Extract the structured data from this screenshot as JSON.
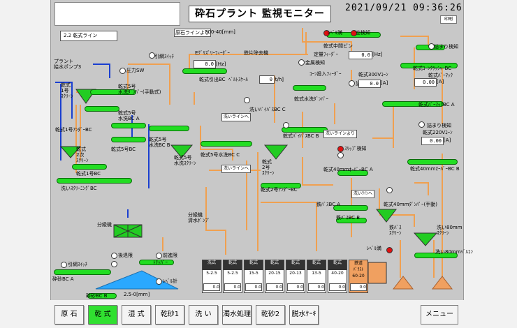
{
  "header": {
    "title": "砕石プラント 監視モニター",
    "datetime": "2021/09/21  09:36:26",
    "print_label": "印刷",
    "line_name": "2.2 乾式ライン"
  },
  "labels": {
    "plant_pump": "プラント\n給水ポンプ3",
    "pressure_sw": "圧力SW",
    "from_crushed_line": "原石ラインより",
    "range_300_40": "300-40[mm]",
    "pull_switch": "引綱ｽｲｯﾁ",
    "e_feeder": "Eｸﾞﾘｽﾞﾘｰﾌｨｰﾀﾞｰ",
    "iron_remover": "鉄片除去機",
    "metal_detect": "金属検知",
    "dry_pull_bc": "乾式引出BC",
    "belt_scale": "ﾍﾞﾙﾄｽｹｰﾙ",
    "hz": "[Hz]",
    "th": "[t/h]",
    "a": "[A]",
    "dry_1_screen": "乾式\n1号\nｽｸﾘｰﾝ",
    "dry_5_damper": "乾式5号\n水洗ﾀﾞﾝﾊﾟｰ(手動式)",
    "dry_5_wash_bc_a": "乾式5号\n水洗BC A",
    "dry_5_wash_bc_b": "乾式5号\n水洗BC B",
    "dry_5_wash_screen": "乾式5号\n水洗ｽｸﾘｰﾝ",
    "dry_1_under_bc": "乾式1号ｱﾝﾀﾞｰBC",
    "dry_5_bc": "乾式5号BC",
    "dry_5_wash_bc_c": "乾式5号水洗BC C",
    "dry_2_screen": "乾式\n2次\nｽｸﾘｰﾝ",
    "dry_1_bc": "乾式1号BC",
    "wash_screening_bc": "洗いｽｸﾘｰﾆﾝｸﾞBC",
    "wash_line_1": "洗いラインへ",
    "wash_line_2": "洗いラインへ",
    "dry_middle_bin": "乾式中間ビン",
    "level_full": "ﾚﾍﾞﾙ満",
    "empty_detect": "空検知",
    "fixed_feeder": "定量ﾌｨｰﾀﾞｰ",
    "cone_feeder": "ｺｰﾝ投入ﾌｨｰﾀﾞｰ",
    "clog_detect": "詰まり検知",
    "dry_300v_cone": "乾式300Vｺｰﾝ",
    "dry_cone_crusher_bc": "乾式ｺｰﾝｸﾗｯｼｬｰBC",
    "dry_bar_mac": "乾式ﾊﾞｰﾏｯｸ",
    "dry_wash_damper": "乾式水洗ﾀﾞﾝﾊﾟｰ",
    "wash_bypass_bc_c": "洗いﾊﾞｲﾊﾟｽBC C",
    "dry_bypass_bc_b": "乾式ﾊﾞｲﾊﾟｽBC B",
    "dry_barmac_bc_a": "乾式ﾊﾞｰﾏｯｸBC A",
    "dry_barmac_bc_b": "乾式ﾊﾞｰﾏｯｸBC B",
    "from_wash_line": "洗いラインより",
    "slip_detect": "ｽﾘｯﾌﾟ検知",
    "dry_2_under_screen": "乾式\n2号\nｽｸﾘｰﾝ",
    "dry_40mm_over_a": "乾式40mmｵｰﾊﾞｰBC A",
    "dry_40mm_over_b": "乾式40mmｵｰﾊﾞｰBC B",
    "dry_220v_cone": "乾式220Vｺｰﾝ",
    "dry_2_under_bc": "乾式2号ｱﾝﾀﾞｰBC",
    "bypass_bc_a": "鉄ﾊﾞｽBC A",
    "bypass_bc_b": "鉄ﾊﾞｽBC B",
    "wash_to": "洗いﾗｲﾝへ",
    "damper_40mm": "乾式40mmﾀﾞﾝﾊﾟｰ(手動)",
    "iron_screen": "鉄ﾊﾞｽ\nｽｸﾘｰﾝ",
    "wash_80mm_screen": "洗い80mm\nｽｸﾘｰﾝ",
    "wash_80mm_bc": "洗い80mmﾍﾞﾙｺﾝ",
    "plant_clear_water": "分級機\n清水ﾎﾟﾝﾌﾟ",
    "classifier": "分級機",
    "rear_limit": "後退限",
    "front_limit": "前進限",
    "tripper": "ﾄﾘｯﾊﾟｰ",
    "level_sensor": "ﾚﾍﾞﾙ計",
    "dry_sand_bc_a": "砕砂BC A",
    "dry_sand_bc_b": "砕砂BC B",
    "sand_range": "2.5-0[mm]",
    "level_full_2": "ﾚﾍﾞﾙ満"
  },
  "values": {
    "feeder_hz": "0.0",
    "belt_scale": "0",
    "fixed_feeder_hz": "0.0",
    "cone300_a": "0.0",
    "barmac_a": "0.00",
    "cone220_a": "0.00"
  },
  "silos": [
    {
      "name": "洗式",
      "range": "5-2.5",
      "val": "0.0"
    },
    {
      "name": "乾式",
      "range": "5-2.5",
      "val": "0.0"
    },
    {
      "name": "乾式",
      "range": "15-5",
      "val": "0.0"
    },
    {
      "name": "乾式",
      "range": "20-15",
      "val": "0.0"
    },
    {
      "name": "乾式",
      "range": "20-13",
      "val": "0.0"
    },
    {
      "name": "乾式",
      "range": "13-5",
      "val": "0.0"
    },
    {
      "name": "乾式",
      "range": "40-20",
      "val": "0.0"
    },
    {
      "name": "鉄道\nﾊﾞﾗｽﾄ\n60-20",
      "range": "",
      "val": "0.0"
    }
  ],
  "nav": {
    "items": [
      "原 石",
      "乾 式",
      "湿 式",
      "乾砂1",
      "洗 い",
      "濁水処理",
      "乾砂2",
      "脱水ｹｰｷ"
    ],
    "menu": "メニュー"
  },
  "colors": {
    "belt": "#22dd22",
    "active": "#30e030",
    "alarm": "#e01010",
    "pipe": "#f0a050",
    "water": "#1a3fd0",
    "silo_orange": "#f0a060"
  }
}
